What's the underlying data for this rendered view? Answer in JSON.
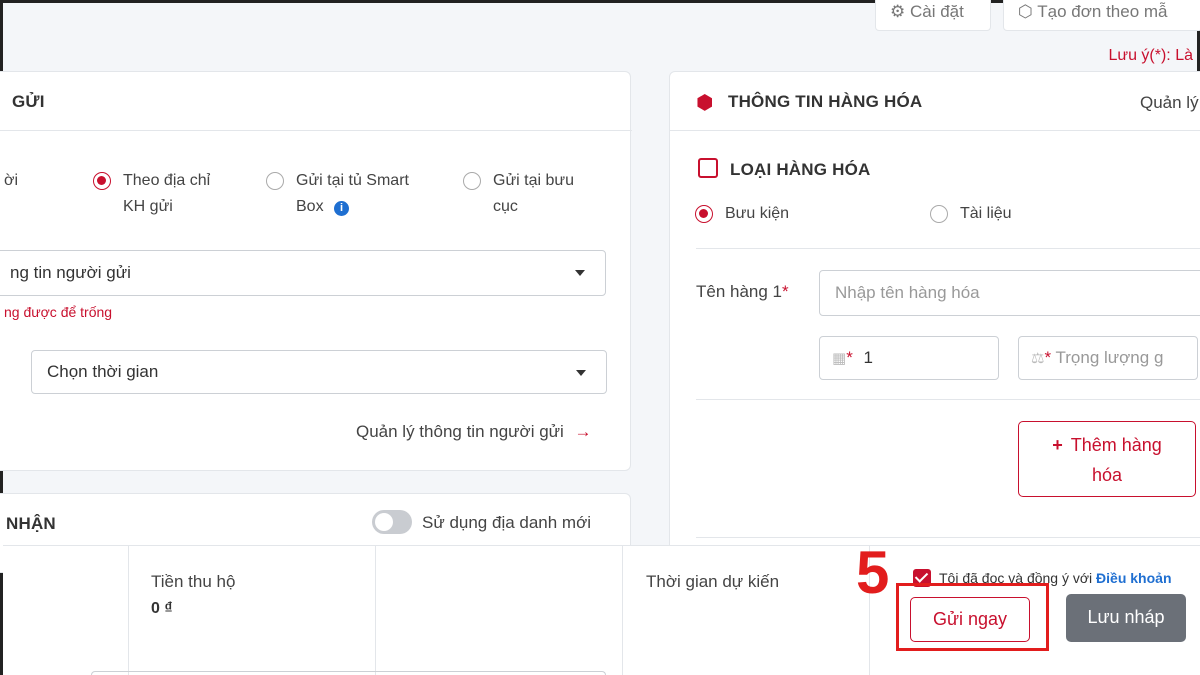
{
  "top": {
    "settings_label": "Cài đặt",
    "create_label": "Tạo đơn theo mẫ",
    "note": "Lưu ý(*): Là"
  },
  "sender": {
    "title": "GỬI",
    "pickup_label_partial": "ời",
    "options": [
      {
        "label_line1": "Theo địa chỉ",
        "label_line2": "KH gửi",
        "selected": true
      },
      {
        "label_line1": "Gửi tại tủ Smart",
        "label_line2": "Box",
        "selected": false
      },
      {
        "label_line1": "Gửi tại bưu",
        "label_line2": "cục",
        "selected": false
      }
    ],
    "sender_select_value": "ng tin người gửi",
    "sender_error": "ng được để trống",
    "time_select_value": "Chọn thời gian",
    "manage_link": "Quản lý thông tin người gửi"
  },
  "receiver": {
    "title": "NHẬN",
    "toggle_label": "Sử dụng địa danh mới"
  },
  "goods": {
    "title": "THÔNG TIN HÀNG HÓA",
    "manage_partial": "Quản lý",
    "type_title": "LOẠI HÀNG HÓA",
    "types": [
      {
        "label": "Bưu kiện",
        "selected": true
      },
      {
        "label": "Tài liệu",
        "selected": false
      }
    ],
    "name_label": "Tên hàng 1",
    "name_placeholder": "Nhập tên hàng hóa",
    "quantity_value": "1",
    "weight_placeholder": "Trọng lượng g",
    "add_line1": "Thêm hàng",
    "add_line2": "hóa"
  },
  "bottom": {
    "cod_label": "Tiền thu hộ",
    "cod_value": "0 ₫",
    "eta_label": "Thời gian dự kiến",
    "agree_text": "Tôi đã đọc và đồng ý với",
    "agree_link": "Điều khoản",
    "send_now": "Gửi ngay",
    "save_draft": "Lưu nháp"
  },
  "annotation": {
    "step_number": "5"
  },
  "colors": {
    "accent": "#c8102e",
    "info": "#1f6fd1",
    "annotation": "#e21d1d"
  }
}
